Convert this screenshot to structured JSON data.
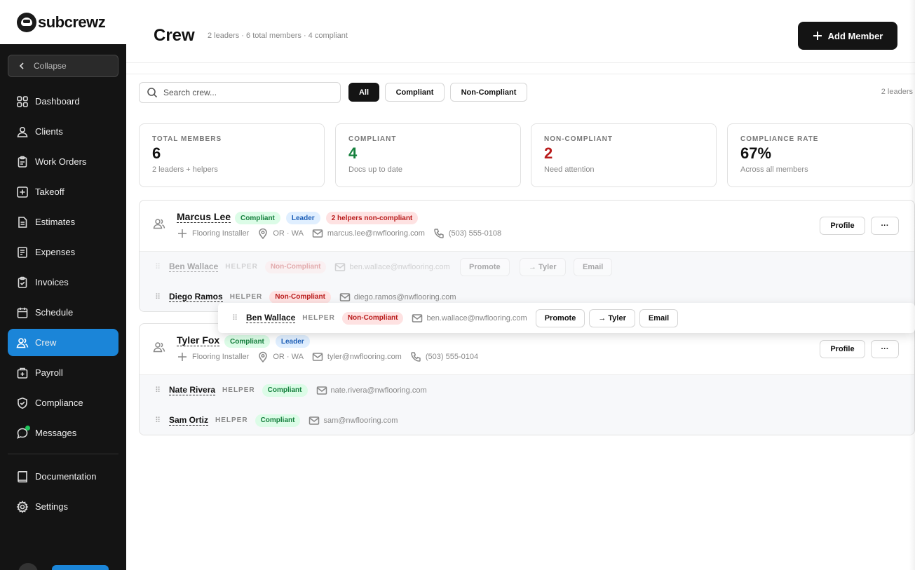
{
  "brand": {
    "name": "subcrewz"
  },
  "sidebar": {
    "collapse_label": "Collapse",
    "items": [
      {
        "label": "Dashboard",
        "icon": "grid-icon"
      },
      {
        "label": "Clients",
        "icon": "user-icon"
      },
      {
        "label": "Work Orders",
        "icon": "clipboard-icon"
      },
      {
        "label": "Takeoff",
        "icon": "plus-square-icon"
      },
      {
        "label": "Estimates",
        "icon": "document-icon"
      },
      {
        "label": "Expenses",
        "icon": "receipt-icon"
      },
      {
        "label": "Invoices",
        "icon": "clipboard-check-icon"
      },
      {
        "label": "Schedule",
        "icon": "calendar-icon"
      },
      {
        "label": "Crew",
        "icon": "users-icon",
        "active": true
      },
      {
        "label": "Payroll",
        "icon": "wallet-icon"
      },
      {
        "label": "Compliance",
        "icon": "shield-check-icon"
      },
      {
        "label": "Messages",
        "icon": "chat-icon",
        "notification": true
      }
    ],
    "footer_items": [
      {
        "label": "Documentation",
        "icon": "book-icon"
      },
      {
        "label": "Settings",
        "icon": "gear-icon"
      }
    ]
  },
  "header": {
    "title": "Crew",
    "subtitle": "2 leaders · 6 total members · 4 compliant",
    "add_button": "Add Member"
  },
  "filters": {
    "search_placeholder": "Search crew...",
    "chips": [
      "All",
      "Compliant",
      "Non-Compliant"
    ],
    "active_chip": "All",
    "right_label": "2 leaders"
  },
  "stats": [
    {
      "label": "TOTAL MEMBERS",
      "value": "6",
      "sub": "2 leaders + helpers"
    },
    {
      "label": "COMPLIANT",
      "value": "4",
      "sub": "Docs up to date"
    },
    {
      "label": "NON-COMPLIANT",
      "value": "2",
      "sub": "Need attention"
    },
    {
      "label": "COMPLIANCE RATE",
      "value": "67%",
      "sub": "Across all members"
    }
  ],
  "colors": {
    "accent": "#1b85d8",
    "compliant": "#15803d",
    "noncompliant": "#b91c1c",
    "sidebar_bg": "#141414"
  },
  "crews": [
    {
      "leader": {
        "name": "Marcus Lee",
        "badges": [
          "Compliant",
          "Leader",
          "2 helpers non-compliant"
        ],
        "trade": "Flooring Installer",
        "region": "OR · WA",
        "email": "marcus.lee@nwflooring.com",
        "phone": "(503) 555-0108",
        "profile_label": "Profile",
        "more_label": "···"
      },
      "helpers": [
        {
          "name": "Ben Wallace",
          "role": "HELPER",
          "status": "Non-Compliant",
          "email": "ben.wallace@nwflooring.com",
          "actions": [
            "Promote",
            "→ Tyler",
            "Email"
          ]
        },
        {
          "name": "Diego Ramos",
          "role": "HELPER",
          "status": "Non-Compliant",
          "email": "diego.ramos@nwflooring.com"
        }
      ]
    },
    {
      "leader": {
        "name": "Tyler Fox",
        "badges": [
          "Compliant",
          "Leader"
        ],
        "trade": "Flooring Installer",
        "region": "OR · WA",
        "email": "tyler@nwflooring.com",
        "phone": "(503) 555-0104",
        "profile_label": "Profile",
        "more_label": "···"
      },
      "helpers": [
        {
          "name": "Nate Rivera",
          "role": "HELPER",
          "status": "Compliant",
          "email": "nate.rivera@nwflooring.com"
        },
        {
          "name": "Sam Ortiz",
          "role": "HELPER",
          "status": "Compliant",
          "email": "sam@nwflooring.com"
        }
      ]
    }
  ],
  "dragging": {
    "name": "Ben Wallace",
    "role": "HELPER",
    "status": "Non-Compliant",
    "email": "ben.wallace@nwflooring.com",
    "actions": [
      "Promote",
      "→ Tyler",
      "Email"
    ]
  }
}
